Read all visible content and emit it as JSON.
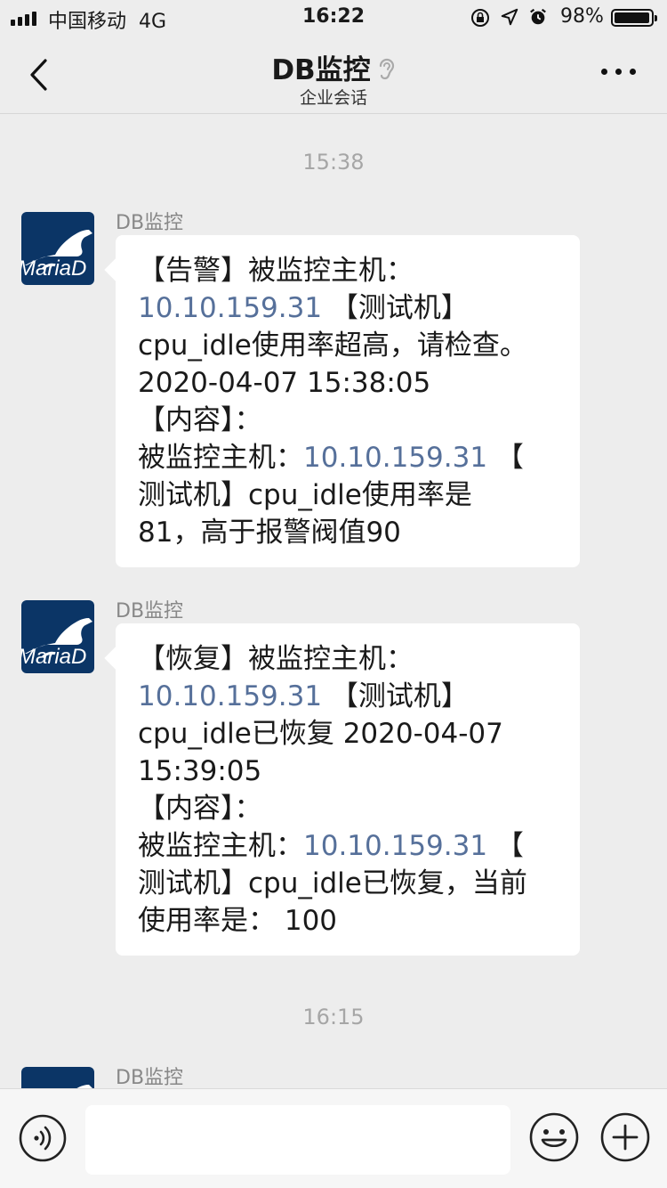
{
  "status_bar": {
    "carrier": "中国移动",
    "network": "4G",
    "time": "16:22",
    "battery_pct": "98%",
    "battery_level": 0.98
  },
  "nav": {
    "title": "DB监控",
    "subtitle": "企业会话",
    "icons": [
      "back-chevron-icon",
      "ear-icon",
      "more-dots-icon"
    ]
  },
  "messages": [
    {
      "timestamp": "15:38",
      "sender": "DB监控",
      "avatar_text": "MariaD",
      "lines": [
        [
          {
            "t": "【告警】被监控主机："
          }
        ],
        [
          {
            "t": "10.10.159.31",
            "link": true
          },
          {
            "t": " 【测试机】"
          }
        ],
        [
          {
            "t": "cpu_idle使用率超高，请检查。"
          }
        ],
        [
          {
            "t": " 2020-04-07 15:38:05"
          }
        ],
        [
          {
            "t": "【内容】："
          }
        ],
        [
          {
            "t": "被监控主机："
          },
          {
            "t": "10.10.159.31",
            "link": true
          },
          {
            "t": " 【"
          }
        ],
        [
          {
            "t": "测试机】cpu_idle使用率是"
          }
        ],
        [
          {
            "t": "81，高于报警阀值90"
          }
        ]
      ]
    },
    {
      "timestamp": "",
      "sender": "DB监控",
      "avatar_text": "MariaD",
      "lines": [
        [
          {
            "t": "【恢复】被监控主机："
          }
        ],
        [
          {
            "t": "10.10.159.31",
            "link": true
          },
          {
            "t": " 【测试机】"
          }
        ],
        [
          {
            "t": "cpu_idle已恢复 2020-04-07"
          }
        ],
        [
          {
            "t": "15:39:05"
          }
        ],
        [
          {
            "t": "【内容】："
          }
        ],
        [
          {
            "t": "被监控主机："
          },
          {
            "t": "10.10.159.31",
            "link": true
          },
          {
            "t": " 【"
          }
        ],
        [
          {
            "t": "测试机】cpu_idle已恢复，当前"
          }
        ],
        [
          {
            "t": "使用率是： 100"
          }
        ]
      ]
    }
  ],
  "third_message": {
    "timestamp": "16:15",
    "sender": "DB监控"
  },
  "bottom_bar": {
    "input_value": "",
    "icons": [
      "voice-icon",
      "emoji-icon",
      "plus-icon"
    ]
  },
  "colors": {
    "background": "#ededed",
    "link": "#56709a",
    "avatar_bg": "#0b3566",
    "timestamp": "#a6a6a6"
  }
}
